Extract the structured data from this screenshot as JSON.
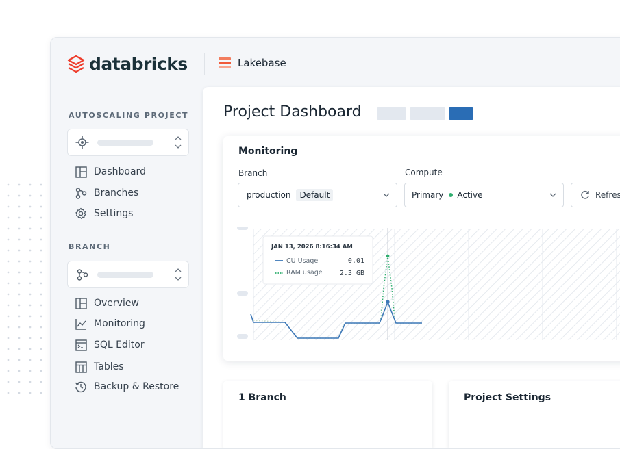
{
  "brand": {
    "name": "databricks",
    "product": "Lakebase"
  },
  "sidebar": {
    "project_section_label": "AUTOSCALING PROJECT",
    "project_nav": [
      {
        "label": "Dashboard",
        "icon": "dashboard-icon"
      },
      {
        "label": "Branches",
        "icon": "branch-icon"
      },
      {
        "label": "Settings",
        "icon": "gear-icon"
      }
    ],
    "branch_section_label": "BRANCH",
    "branch_nav": [
      {
        "label": "Overview",
        "icon": "dashboard-icon"
      },
      {
        "label": "Monitoring",
        "icon": "line-chart-icon"
      },
      {
        "label": "SQL Editor",
        "icon": "terminal-icon"
      },
      {
        "label": "Tables",
        "icon": "table-icon"
      },
      {
        "label": "Backup & Restore",
        "icon": "history-icon"
      }
    ]
  },
  "main": {
    "title": "Project Dashboard",
    "colors": {
      "placeholder": "#e3e8ef",
      "primary": "#2a6db5"
    }
  },
  "monitoring": {
    "title": "Monitoring",
    "branch_label": "Branch",
    "branch_value": "production",
    "branch_badge": "Default",
    "compute_label": "Compute",
    "compute_value": "Primary",
    "compute_status": "Active",
    "refresh_label": "Refres"
  },
  "tooltip": {
    "timestamp": "JAN 13, 2026 8:16:34 AM",
    "rows": [
      {
        "name": "CU Usage",
        "value": "0.01"
      },
      {
        "name": "RAM usage",
        "value": "2.3 GB"
      }
    ]
  },
  "chart_data": {
    "type": "line",
    "series": [
      {
        "name": "CU Usage",
        "color": "#3d78b8",
        "style": "solid"
      },
      {
        "name": "RAM usage",
        "color": "#2fae6f",
        "style": "dotted"
      }
    ]
  },
  "bottom": {
    "branch_count_title": "1 Branch",
    "settings_title": "Project Settings"
  }
}
